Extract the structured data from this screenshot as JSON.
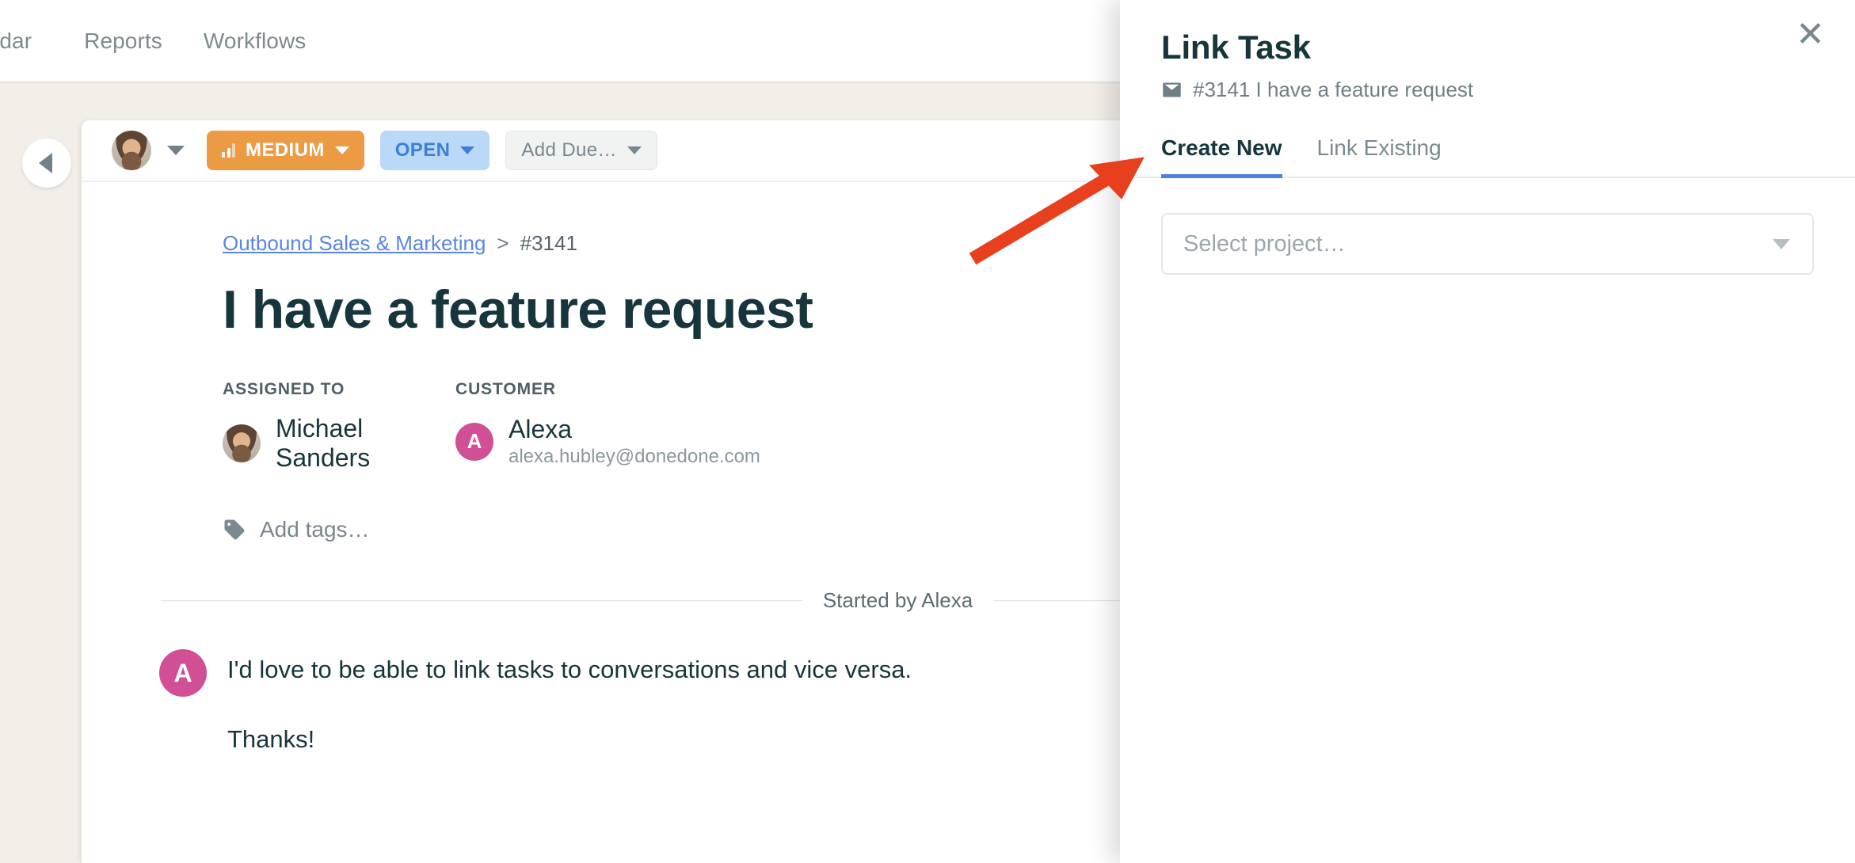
{
  "topnav": {
    "items": [
      {
        "label": "endar",
        "partial": true
      },
      {
        "label": "Reports",
        "partial": false
      },
      {
        "label": "Workflows",
        "partial": false
      }
    ]
  },
  "toolbar": {
    "assignee_dropdown_label": "",
    "priority_label": "MEDIUM",
    "status_label": "OPEN",
    "due_label": "Add Due…"
  },
  "ticket": {
    "breadcrumb_project": "Outbound Sales & Marketing",
    "breadcrumb_separator": ">",
    "breadcrumb_id": "#3141",
    "title": "I have a feature request",
    "assigned_label": "ASSIGNED TO",
    "assigned_name": "Michael Sanders",
    "customer_label": "CUSTOMER",
    "customer_name": "Alexa",
    "customer_initial": "A",
    "customer_email": "alexa.hubley@donedone.com",
    "tags_placeholder": "Add tags…",
    "started_by": "Started by Alexa",
    "message_initial": "A",
    "message_line1": "I'd love to be able to link tasks to conversations and vice versa.",
    "message_line2": "Thanks!"
  },
  "panel": {
    "title": "Link Task",
    "subtitle": "#3141 I have a feature request",
    "close_label": "✕",
    "tabs": [
      {
        "label": "Create New",
        "active": true
      },
      {
        "label": "Link Existing",
        "active": false
      }
    ],
    "select_placeholder": "Select project…"
  },
  "colors": {
    "workspace_bg": "#f3eee7",
    "priority_orange": "#ec9a44",
    "status_blue_bg": "#bad8f7",
    "status_blue_text": "#3d7fd6",
    "accent_tab_underline": "#4a7fe8",
    "customer_pink": "#d14f94",
    "heading_dark": "#16353c",
    "muted_gray": "#7b8a91",
    "link_blue": "#5b86e0",
    "annotation_red": "#e8401f"
  }
}
